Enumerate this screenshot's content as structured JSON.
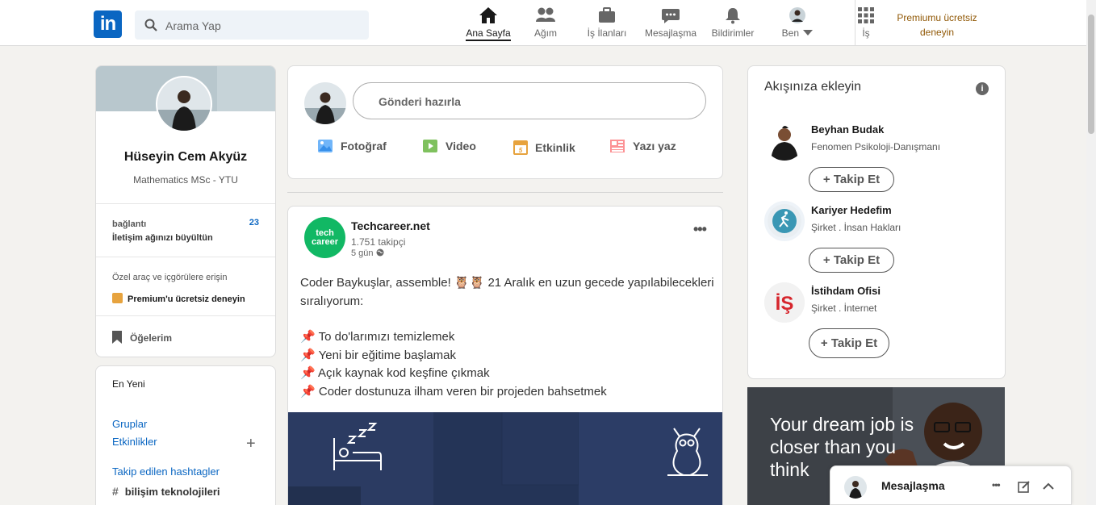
{
  "header": {
    "logo": "in",
    "search_placeholder": "Arama Yap",
    "nav": [
      {
        "label": "Ana Sayfa"
      },
      {
        "label": "Ağım"
      },
      {
        "label": "İş İlanları"
      },
      {
        "label": "Mesajlaşma"
      },
      {
        "label": "Bildirimler"
      },
      {
        "label": "Ben"
      },
      {
        "label": "İş"
      }
    ],
    "premium_line1": "Premiumu ücretsiz",
    "premium_line2": "deneyin"
  },
  "profile": {
    "name": "Hüseyin Cem Akyüz",
    "headline": "Mathematics MSc - YTU",
    "connections_label": "bağlantı",
    "connections_count": "23",
    "grow_network": "İletişim ağınızı büyültün",
    "tools_text": "Özel araç ve içgörülere erişin",
    "premium_try": "Premium'u ücretsiz deneyin",
    "items_label": "Öğelerim"
  },
  "recent": {
    "heading": "En Yeni",
    "groups": "Gruplar",
    "events": "Etkinlikler",
    "hashtags_heading": "Takip edilen hashtagler",
    "hashtag": "bilişim teknolojileri"
  },
  "composer": {
    "placeholder": "Gönderi hazırla",
    "actions": [
      {
        "label": "Fotoğraf"
      },
      {
        "label": "Video"
      },
      {
        "label": "Etkinlik"
      },
      {
        "label": "Yazı yaz"
      }
    ]
  },
  "post": {
    "author": "Techcareer.net",
    "logo_line1": "tech",
    "logo_line2": "career",
    "followers": "1.751 takipçi",
    "time": "5 gün",
    "line1": "Coder Baykuşlar, assemble! 🦉🦉 21 Aralık en uzun gecede yapılabilecekleri sıralıyorum:",
    "items": [
      "To do'larımızı temizlemek",
      "Yeni bir eğitime başlamak",
      "Açık kaynak kod keşfine çıkmak",
      "Coder dostunuza ilham veren bir projeden bahsetmek"
    ]
  },
  "suggestions": {
    "heading": "Akışınıza ekleyin",
    "follow_label": "+ Takip Et",
    "people": [
      {
        "name": "Beyhan Budak",
        "subtitle": "Fenomen Psikoloji-Danışmanı"
      },
      {
        "name": "Kariyer Hedefim",
        "subtitle": "Şirket . İnsan Hakları"
      },
      {
        "name": "İstihdam Ofisi",
        "subtitle": "Şirket . İnternet"
      }
    ]
  },
  "ad": {
    "text": "Your dream job is closer than you think"
  },
  "messaging": {
    "label": "Mesajlaşma"
  },
  "colors": {
    "brand": "#0a66c2",
    "premium": "#915907",
    "page_bg": "#f3f2ef"
  }
}
